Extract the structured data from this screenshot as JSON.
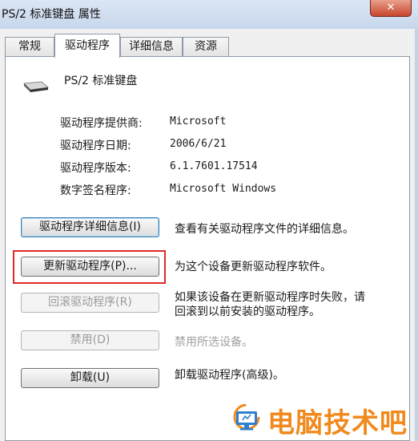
{
  "window": {
    "title": "PS/2 标准键盘 属性",
    "close_glyph": "✕"
  },
  "tabs": [
    {
      "label": "常规",
      "active": false
    },
    {
      "label": "驱动程序",
      "active": true
    },
    {
      "label": "详细信息",
      "active": false
    },
    {
      "label": "资源",
      "active": false
    }
  ],
  "device": {
    "name": "PS/2 标准键盘",
    "icon": "keyboard-icon"
  },
  "driver_info": [
    {
      "label": "驱动程序提供商:",
      "value": "Microsoft"
    },
    {
      "label": "驱动程序日期:",
      "value": "2006/6/21"
    },
    {
      "label": "驱动程序版本:",
      "value": "6.1.7601.17514"
    },
    {
      "label": "数字签名程序:",
      "value": "Microsoft Windows"
    }
  ],
  "actions": [
    {
      "button": "驱动程序详细信息(I)",
      "description": "查看有关驱动程序文件的详细信息。",
      "enabled": true
    },
    {
      "button": "更新驱动程序(P)...",
      "description": "为这个设备更新驱动程序软件。",
      "enabled": true
    },
    {
      "button": "回滚驱动程序(R)",
      "description_line1": "如果该设备在更新驱动程序时失败，请",
      "description_line2": "回滚到以前安装的驱动程序。",
      "enabled": false
    },
    {
      "button": "禁用(D)",
      "description": "禁用所选设备。",
      "enabled": false
    },
    {
      "button": "卸载(U)",
      "description": "卸载驱动程序(高级)。",
      "enabled": true
    }
  ],
  "watermark": {
    "text": "电脑技术吧",
    "icon": "monitor-logo-icon"
  },
  "colors": {
    "highlight": "#e02a2a",
    "watermark": "#f08a1e",
    "titlebar": "#c7d7ec"
  }
}
